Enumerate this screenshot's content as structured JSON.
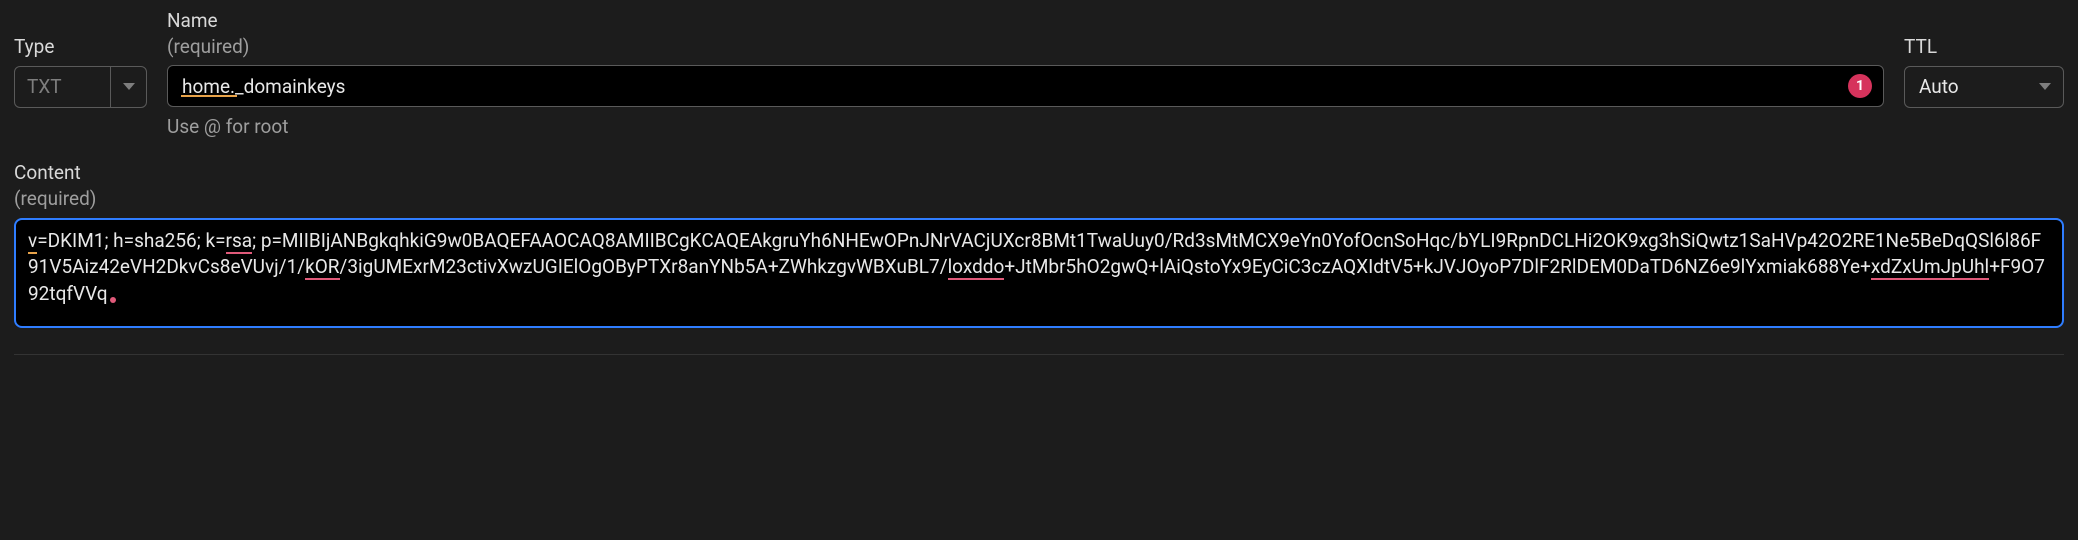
{
  "labels": {
    "type": "Type",
    "name": "Name",
    "required": "(required)",
    "ttl": "TTL",
    "name_helper": "Use @ for root",
    "content": "Content"
  },
  "type": {
    "value": "TXT"
  },
  "name": {
    "value": "home._domainkeys",
    "error_count": "1"
  },
  "ttl": {
    "value": "Auto"
  },
  "content": {
    "value": "v=DKIM1; h=sha256; k=rsa; p=MIIBIjANBgkqhkiG9w0BAQEFAAOCAQ8AMIIBCgKCAQEAkgruYh6NHEwOPnJNrVACjUXcr8BMt1TwaUuy0/Rd3sMtMCX9eYn0YofOcnSoHqc/bYLI9RpnDCLHi2OK9xg3hSiQwtz1SaHVp42O2RE1Ne5BeDqQSl6l86F91V5Aiz42eVH2DkvCs8eVUvj/1/kOR/3igUMExrM23ctivXwzUGIElOgOByPTXr8anYNb5A+ZWhkzgvWBXuBL7/loxddo+JtMbr5hO2gwQ+lAiQstoYx9EyCiC3czAQXIdtV5+kJVJOyoP7DlF2RlDEM0DaTD6NZ6e9lYxmiak688Ye+xdZxUmJpUhl+F9O792tqfVVq",
    "segments": [
      {
        "t": "v",
        "u": "orange"
      },
      {
        "t": "=DKIM1; h=sha256; k="
      },
      {
        "t": "rsa",
        "u": "red"
      },
      {
        "t": "; p=MIIBIjANBgkqhkiG9w0BAQEFAAOCAQ8AMIIBCgKCAQEAkgruYh6NHEwOPnJNrVACjUXcr8BMt1TwaUuy0/Rd3sMtMCX9eYn0YofOcnSoHqc/bYLI9RpnDCLHi2OK9xg3hSiQwtz1SaHVp42O2RE1Ne5BeDqQSl6l86F91V5Aiz42eVH2DkvCs8eVUvj/1/"
      },
      {
        "t": "kOR",
        "u": "red"
      },
      {
        "t": "/3igUMExrM23ctivXwzUGIElOgOByPTXr8anYNb5A+ZWhkzgvWBXuBL7/"
      },
      {
        "t": "loxddo",
        "u": "red"
      },
      {
        "t": "+JtMbr5hO2gwQ+lAiQstoYx9EyCiC3czAQXIdtV5+kJVJOyoP7DlF2RlDEM0DaTD6NZ6e9lYxmiak688Ye+"
      },
      {
        "t": "xdZxUmJpUhl",
        "u": "red"
      },
      {
        "t": "+F9O792tqfVVq"
      }
    ]
  },
  "colors": {
    "bg": "#1c1c1c",
    "input_bg": "#000000",
    "border": "#5a5a5a",
    "focus_border": "#2f7dff",
    "error_badge": "#d6335c",
    "underline_orange": "#e8a34a",
    "underline_red": "#e05a7a"
  }
}
